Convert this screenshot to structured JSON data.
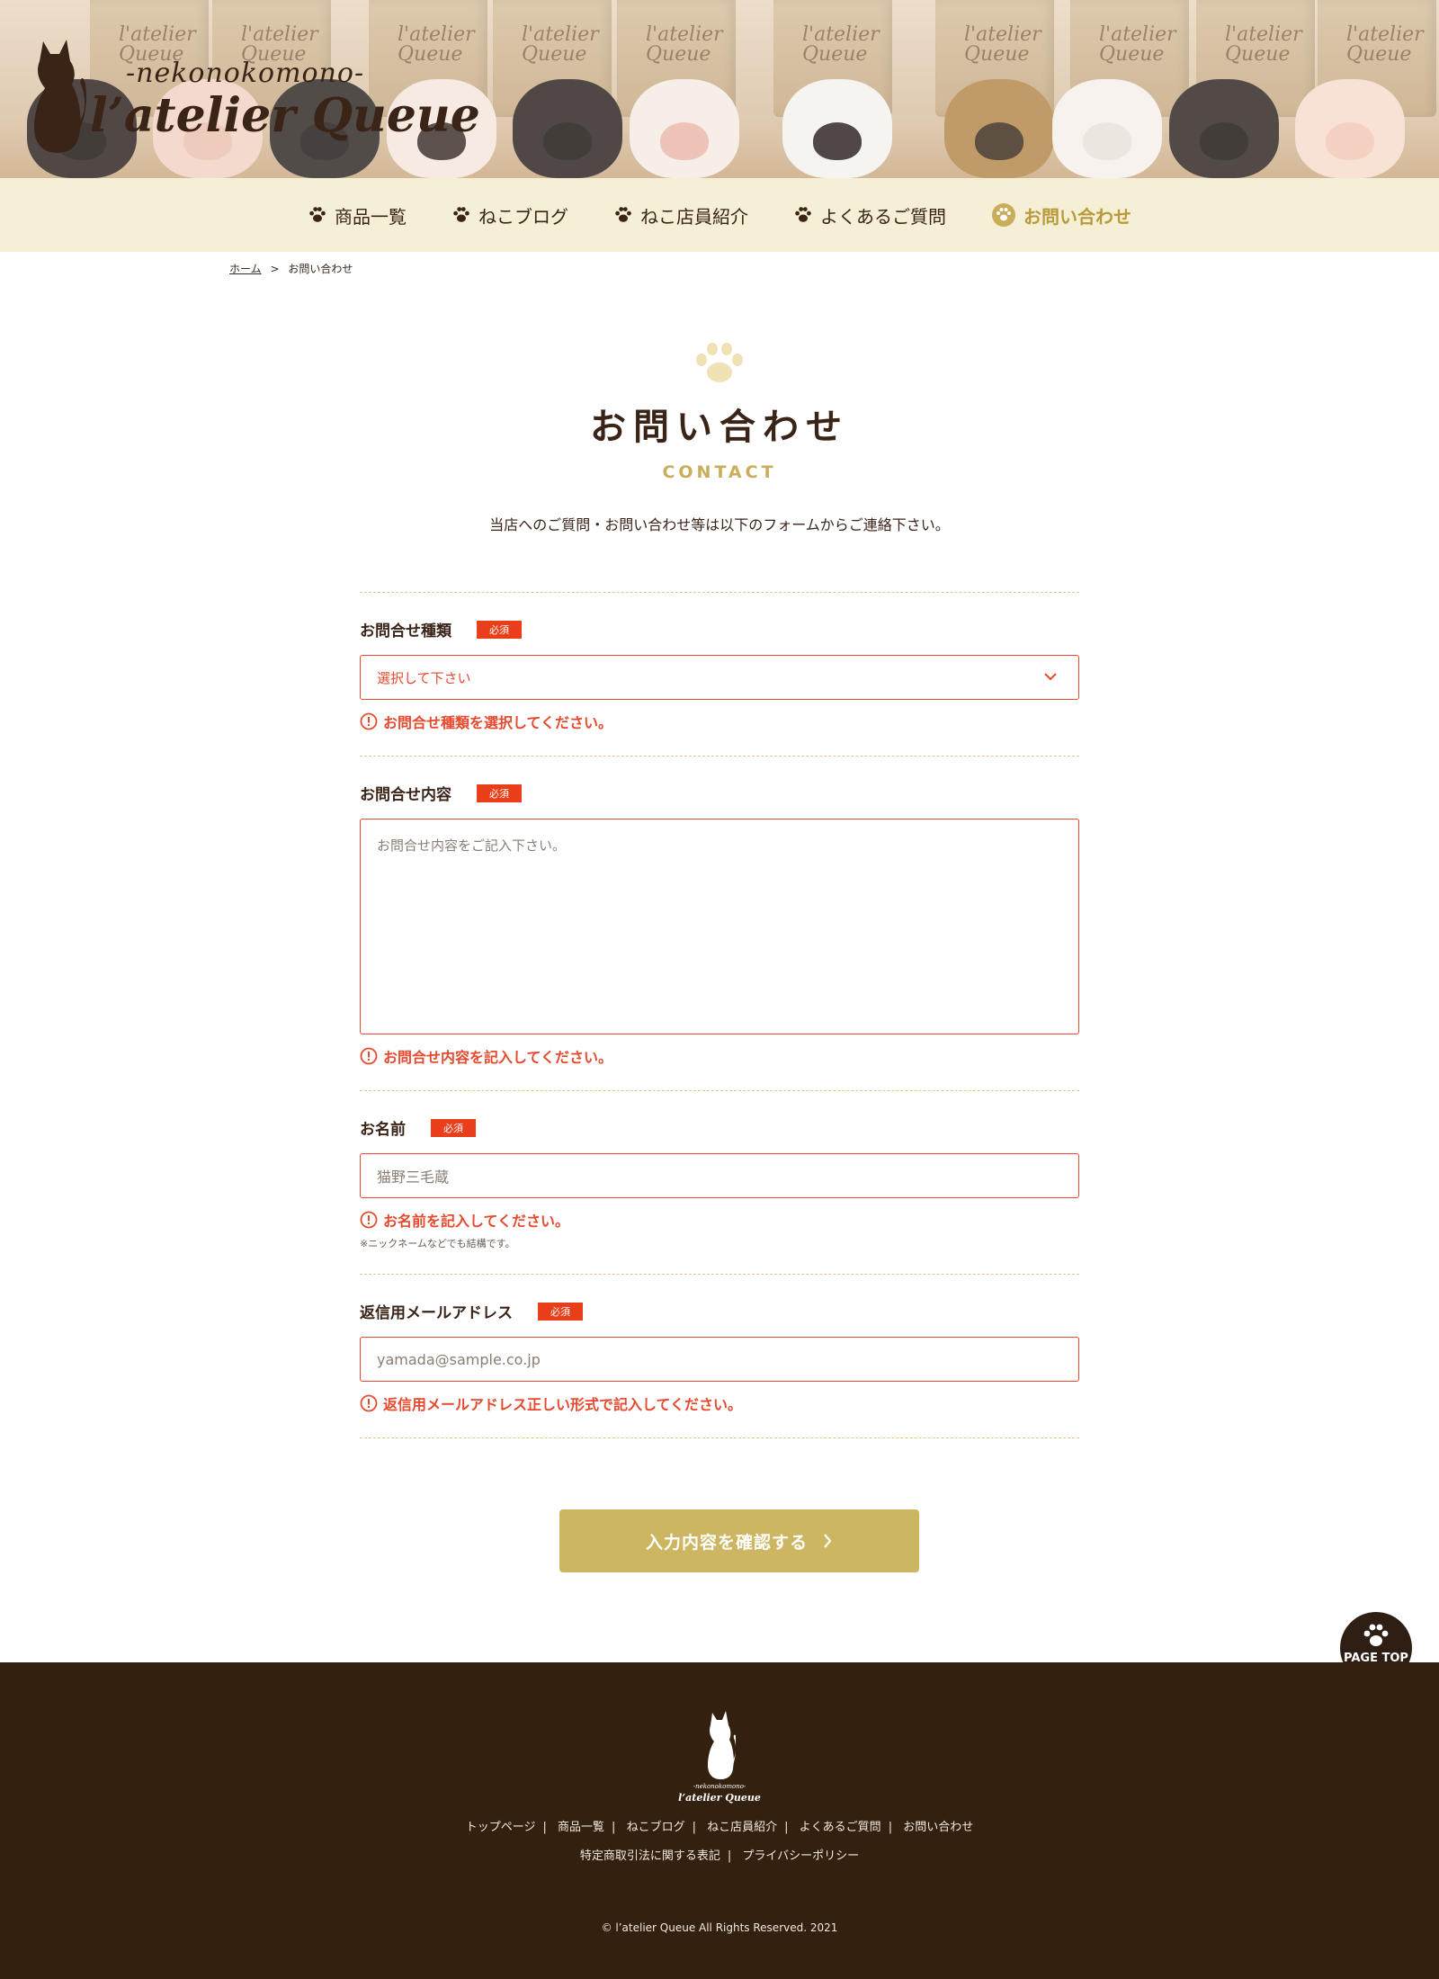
{
  "header": {
    "logo_sub": "-nekonokomono-",
    "logo_main": "l’atelier Queue",
    "bag_text": "l'atelier Queue"
  },
  "nav": {
    "items": [
      {
        "label": "商品一覧",
        "active": false
      },
      {
        "label": "ねこブログ",
        "active": false
      },
      {
        "label": "ねこ店員紹介",
        "active": false
      },
      {
        "label": "よくあるご質問",
        "active": false
      },
      {
        "label": "お問い合わせ",
        "active": true
      }
    ]
  },
  "breadcrumb": {
    "home": "ホーム",
    "separator": ">",
    "current": "お問い合わせ"
  },
  "page": {
    "title": "お問い合わせ",
    "subtitle": "CONTACT",
    "lead": "当店へのご質問・お問い合わせ等は以下のフォームからご連絡下さい。"
  },
  "form": {
    "required_label": "必須",
    "type": {
      "label": "お問合せ種類",
      "selected": "選択して下さい",
      "error": "お問合せ種類を選択してください。"
    },
    "content": {
      "label": "お問合せ内容",
      "placeholder": "お問合せ内容をご記入下さい。",
      "error": "お問合せ内容を記入してください。"
    },
    "name": {
      "label": "お名前",
      "placeholder": "猫野三毛蔵",
      "error": "お名前を記入してください。",
      "note": "※ニックネームなどでも結構です。"
    },
    "email": {
      "label": "返信用メールアドレス",
      "placeholder": "yamada@sample.co.jp",
      "error": "返信用メールアドレス正しい形式で記入してください。"
    },
    "submit": "入力内容を確認する"
  },
  "pagetop": "PAGE TOP",
  "footer": {
    "logo_sub": "-nekonokomono-",
    "logo_main": "l’atelier Queue",
    "links": [
      "トップページ",
      "商品一覧",
      "ねこブログ",
      "ねこ店員紹介",
      "よくあるご質問",
      "お問い合わせ"
    ],
    "links2": [
      "特定商取引法に関する表記",
      "プライバシーポリシー"
    ],
    "copyright": "© l’atelier Queue All Rights Reserved. 2021"
  },
  "colors": {
    "brand_brown": "#33200f",
    "nav_bg": "#f5efd6",
    "accent_gold": "#cdb662",
    "error_red": "#e64a2e",
    "required_red": "#ea3d19"
  }
}
